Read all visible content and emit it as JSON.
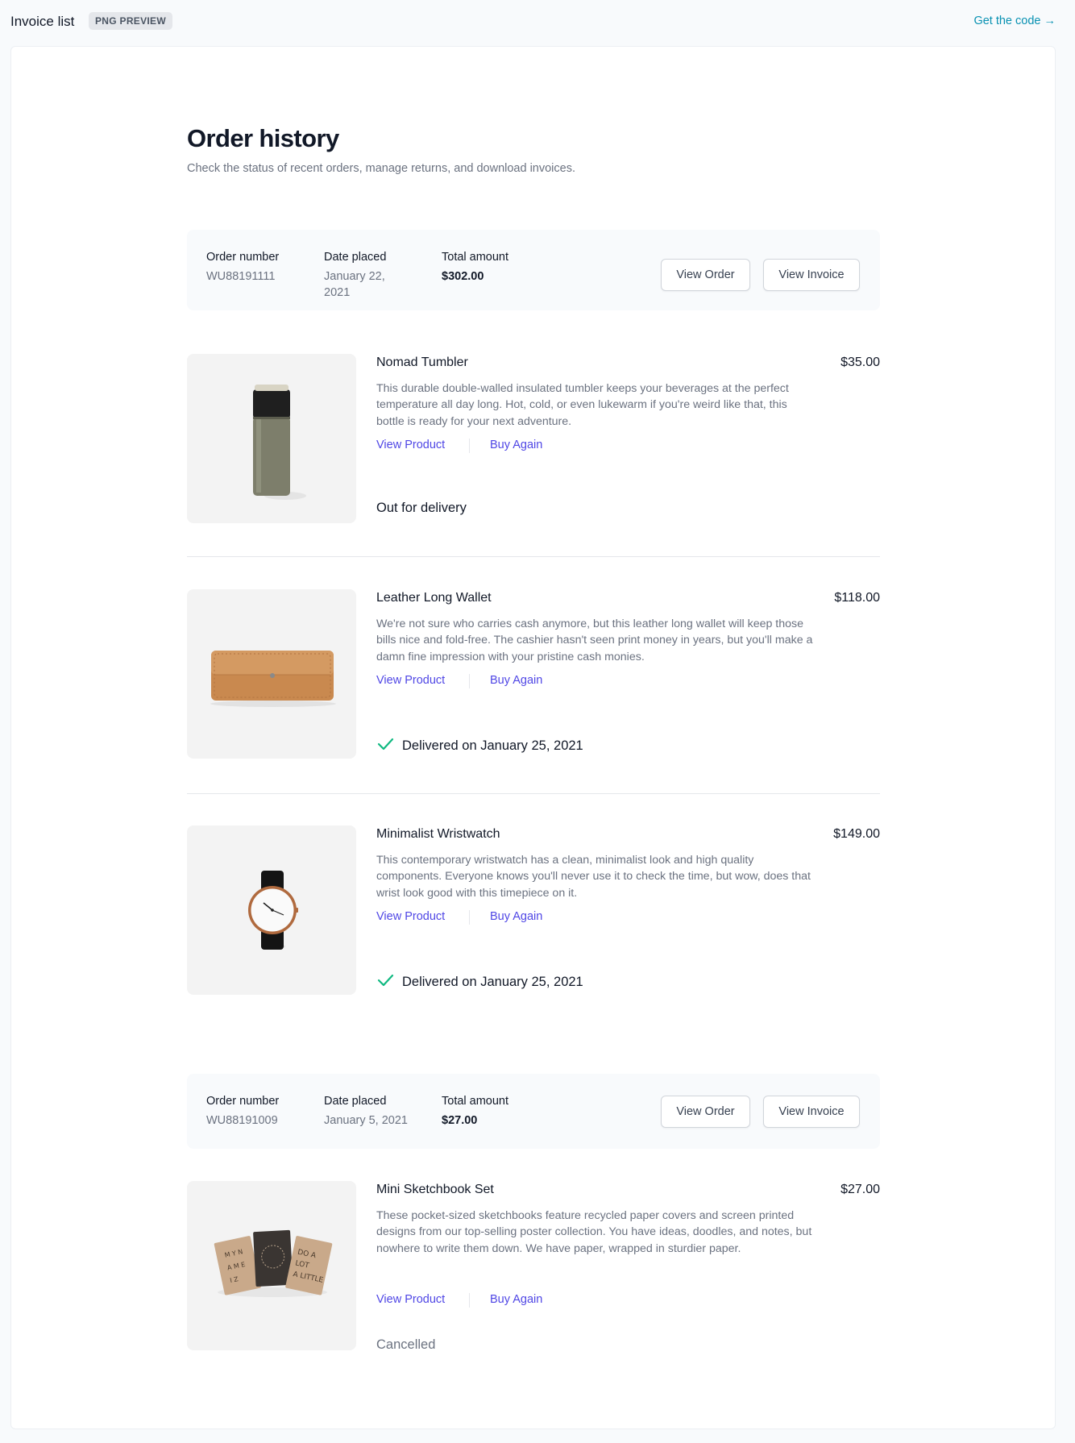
{
  "topbar": {
    "title": "Invoice list",
    "badge": "PNG PREVIEW",
    "code_link": "Get the code →"
  },
  "page": {
    "title": "Order history",
    "subtitle": "Check the status of recent orders, manage returns, and download invoices."
  },
  "labels": {
    "order_number": "Order number",
    "date_placed": "Date placed",
    "total_amount": "Total amount",
    "view_order": "View Order",
    "view_invoice": "View Invoice",
    "view_product": "View Product",
    "buy_again": "Buy Again"
  },
  "colors": {
    "accent": "#4f46e5",
    "code_link": "#0891b2",
    "success": "#10b981"
  },
  "orders": [
    {
      "number": "WU88191111",
      "date": "January 22, 2021",
      "total": "$302.00",
      "products": [
        {
          "name": "Nomad Tumbler",
          "price": "$35.00",
          "description": "This durable double-walled insulated tumbler keeps your beverages at the perfect temperature all day long. Hot, cold, or even lukewarm if you're weird like that, this bottle is ready for your next adventure.",
          "status": "Out for delivery",
          "image_icon": "tumbler-image"
        },
        {
          "name": "Leather Long Wallet",
          "price": "$118.00",
          "description": "We're not sure who carries cash anymore, but this leather long wallet will keep those bills nice and fold-free. The cashier hasn't seen print money in years, but you'll make a damn fine impression with your pristine cash monies.",
          "status": "Delivered on January 25, 2021",
          "status_icon": "check-icon",
          "image_icon": "wallet-image"
        },
        {
          "name": "Minimalist Wristwatch",
          "price": "$149.00",
          "description": "This contemporary wristwatch has a clean, minimalist look and high quality components. Everyone knows you'll never use it to check the time, but wow, does that wrist look good with this timepiece on it.",
          "status": "Delivered on January 25, 2021",
          "status_icon": "check-icon",
          "image_icon": "wristwatch-image"
        }
      ]
    },
    {
      "number": "WU88191009",
      "date": "January 5, 2021",
      "total": "$27.00",
      "products": [
        {
          "name": "Mini Sketchbook Set",
          "price": "$27.00",
          "description": "These pocket-sized sketchbooks feature recycled paper covers and screen printed designs from our top-selling poster collection. You have ideas, doodles, and notes, but nowhere to write them down. We have paper, wrapped in sturdier paper.",
          "status": "Cancelled",
          "image_icon": "sketchbook-image"
        }
      ]
    }
  ]
}
